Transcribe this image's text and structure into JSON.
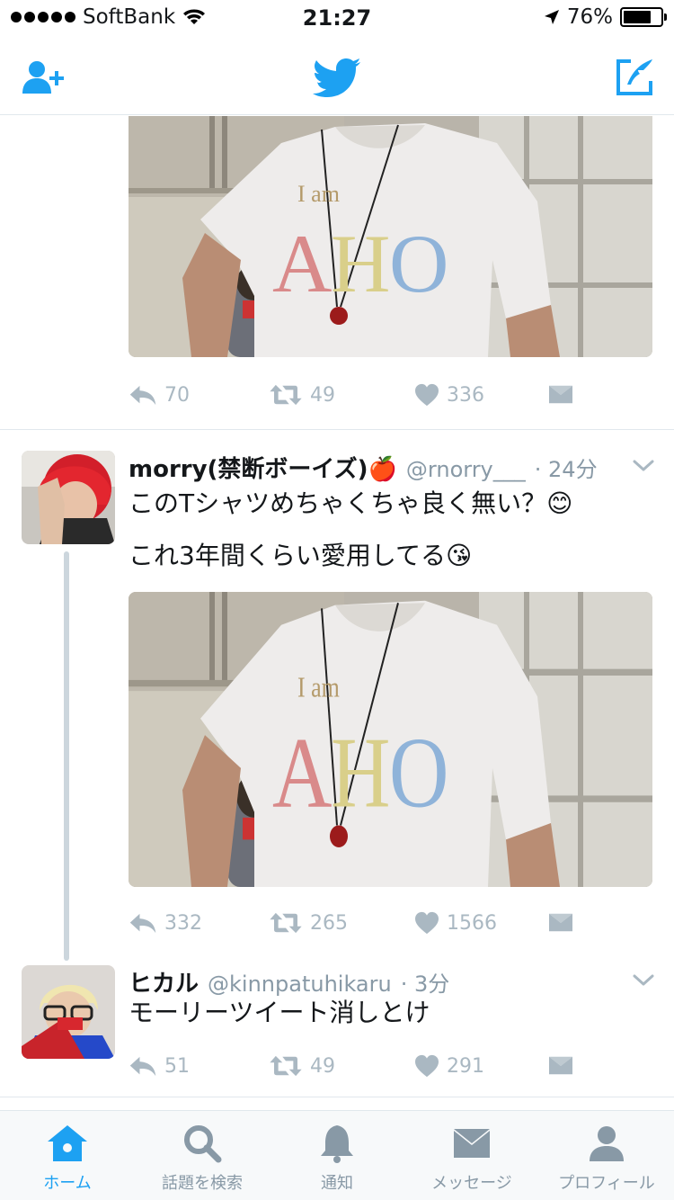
{
  "status_bar": {
    "carrier": "SoftBank",
    "time": "21:27",
    "battery": "76%",
    "battery_level": 0.76
  },
  "colors": {
    "accent": "#1da1f2",
    "muted": "#aab8c2",
    "text": "#14171a",
    "handle": "#8899a6"
  },
  "header": {
    "left_icon": "add-user-icon",
    "center_icon": "twitter-bird-icon",
    "right_icon": "compose-tweet-icon"
  },
  "tweets": [
    {
      "photo": {
        "shirt_line1": "I am",
        "shirt_line2": "AHO"
      },
      "actions": {
        "replies": "70",
        "retweets": "49",
        "likes": "336"
      }
    },
    {
      "name": "morry(禁断ボーイズ)🍎",
      "handle": "@rnorry___",
      "time": "· 24分",
      "text_line1": "このTシャツめちゃくちゃ良く無い？😊",
      "text_line2": "これ3年間くらい愛用してる😘",
      "photo": {
        "shirt_line1": "I am",
        "shirt_line2": "AHO"
      },
      "actions": {
        "replies": "332",
        "retweets": "265",
        "likes": "1566"
      }
    },
    {
      "name": "ヒカル",
      "handle": "@kinnpatuhikaru",
      "time": "· 3分",
      "text": "モーリーツイート消しとけ",
      "actions": {
        "replies": "51",
        "retweets": "49",
        "likes": "291"
      }
    }
  ],
  "tabs": [
    {
      "label": "ホーム",
      "icon": "home-icon",
      "active": true
    },
    {
      "label": "話題を検索",
      "icon": "search-icon",
      "active": false
    },
    {
      "label": "通知",
      "icon": "bell-icon",
      "active": false
    },
    {
      "label": "メッセージ",
      "icon": "envelope-icon",
      "active": false
    },
    {
      "label": "プロフィール",
      "icon": "person-icon",
      "active": false
    }
  ]
}
